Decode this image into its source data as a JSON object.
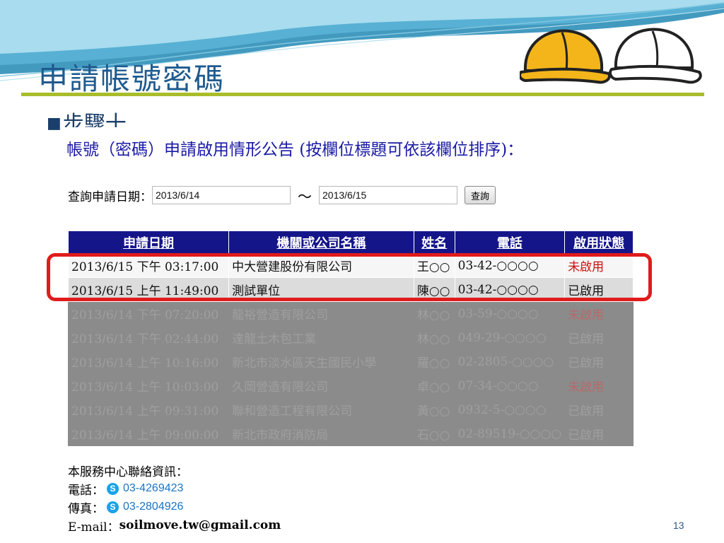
{
  "slide": {
    "title": "申請帳號密碼",
    "step_bullet": "■",
    "step_label": "步驟十",
    "page_number": "13"
  },
  "page": {
    "heading": "帳號（密碼）申請啟用情形公告 (按欄位標題可依該欄位排序)：",
    "query": {
      "label": "查詢申請日期：",
      "start_date": "2013/6/14",
      "separator": "～",
      "end_date": "2013/6/15",
      "button_label": "查詢"
    },
    "table": {
      "headers": [
        "申請日期",
        "機關或公司名稱",
        "姓名",
        "電話",
        "啟用狀態"
      ],
      "rows": [
        {
          "date": "2013/6/15 下午 03:17:00",
          "org": "中大營建股份有限公司",
          "name": "王○○",
          "phone": "03-42-○○○○",
          "status": "未啟用"
        },
        {
          "date": "2013/6/15 上午 11:49:00",
          "org": "測試單位",
          "name": "陳○○",
          "phone": "03-42-○○○○",
          "status": "已啟用"
        },
        {
          "date": "2013/6/14 下午 07:20:00",
          "org": "龍裕營造有限公司",
          "name": "林○○",
          "phone": "03-59-○○○○",
          "status": "未啟用"
        },
        {
          "date": "2013/6/14 下午 02:44:00",
          "org": "達龍土木包工業",
          "name": "林○○",
          "phone": "049-29-○○○○",
          "status": "已啟用"
        },
        {
          "date": "2013/6/14 上午 10:16:00",
          "org": "新北市淡水區天生國民小學",
          "name": "羅○○",
          "phone": "02-2805-○○○○",
          "status": "已啟用"
        },
        {
          "date": "2013/6/14 上午 10:03:00",
          "org": "久岡營造有限公司",
          "name": "卓○○",
          "phone": "07-34-○○○○",
          "status": "未啟用"
        },
        {
          "date": "2013/6/14 上午 09:31:00",
          "org": "聯和營造工程有限公司",
          "name": "黃○○",
          "phone": "0932-5-○○○○",
          "status": "已啟用"
        },
        {
          "date": "2013/6/14 上午 09:00:00",
          "org": "新北市政府消防局",
          "name": "石○○",
          "phone": "02-89519-○○○○",
          "status": "已啟用"
        }
      ]
    },
    "contact": {
      "title": "本服務中心聯絡資訊：",
      "phone_label": "電話：",
      "phone": "03-4269423",
      "fax_label": "傳真：",
      "fax": "03-2804926",
      "email_label": "E-mail：",
      "email": "soilmove.tw@gmail.com"
    }
  },
  "colors": {
    "title": "#1f5a8e",
    "rule": "#a9bd2b",
    "table_header": "#15158a",
    "inactive_status": "#cc1111",
    "highlight": "#e01b1b"
  },
  "icons": [
    "hard-hat-yellow-icon",
    "hard-hat-white-icon",
    "skype-icon"
  ]
}
